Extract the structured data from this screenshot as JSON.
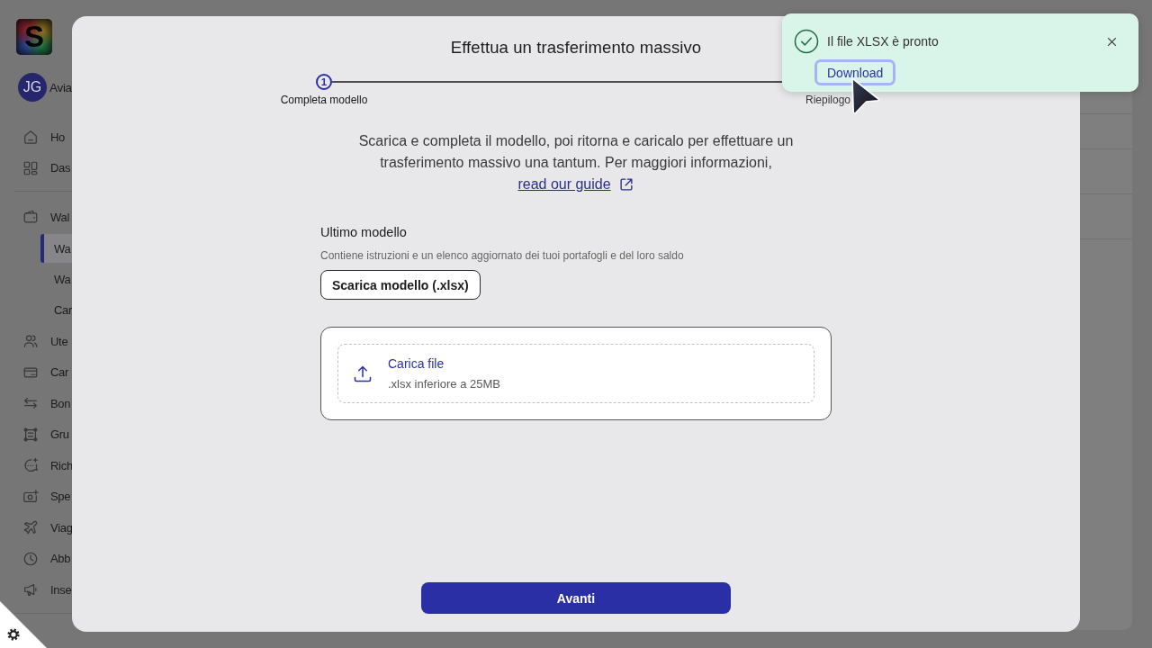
{
  "sidebar": {
    "logo": "S",
    "user": {
      "initials": "JG",
      "name": "Avia"
    },
    "sections": [
      {
        "items": [
          {
            "label": "Ho",
            "selected": false
          },
          {
            "label": "Das",
            "selected": false
          }
        ]
      },
      {
        "items": [
          {
            "label": "Wal",
            "selected": false,
            "children": [
              {
                "label": "Wa",
                "selected": true
              },
              {
                "label": "Wa",
                "selected": false
              },
              {
                "label": "Car",
                "selected": false
              }
            ]
          },
          {
            "label": "Ute",
            "selected": false
          },
          {
            "label": "Car",
            "selected": false
          },
          {
            "label": "Bon",
            "selected": false
          },
          {
            "label": "Gru",
            "selected": false
          },
          {
            "label": "Rich",
            "selected": false
          },
          {
            "label": "Spe",
            "selected": false
          },
          {
            "label": "Viag",
            "selected": false
          },
          {
            "label": "Abb",
            "selected": false
          },
          {
            "label": "Inse",
            "selected": false
          }
        ]
      }
    ]
  },
  "modal": {
    "title": "Effettua un trasferimento massivo",
    "steps": [
      {
        "number": "1",
        "label": "Completa modello",
        "current": true
      },
      {
        "label": "Riepilogo",
        "current": false
      }
    ],
    "intro": {
      "text": "Scarica e completa il modello, poi ritorna e caricalo per effettuare un trasferimento massivo una tantum. Per maggiori informazioni,",
      "link": "read our guide"
    },
    "template": {
      "heading": "Ultimo modello",
      "description": "Contiene istruzioni e un elenco aggiornato dei tuoi portafogli e del loro saldo",
      "button": "Scarica modello (.xlsx)"
    },
    "upload": {
      "title": "Carica file",
      "hint": ".xlsx inferiore a 25MB"
    },
    "next_button": "Avanti"
  },
  "toast": {
    "message": "Il file XLSX è pronto",
    "action": "Download",
    "action_focused": true
  }
}
